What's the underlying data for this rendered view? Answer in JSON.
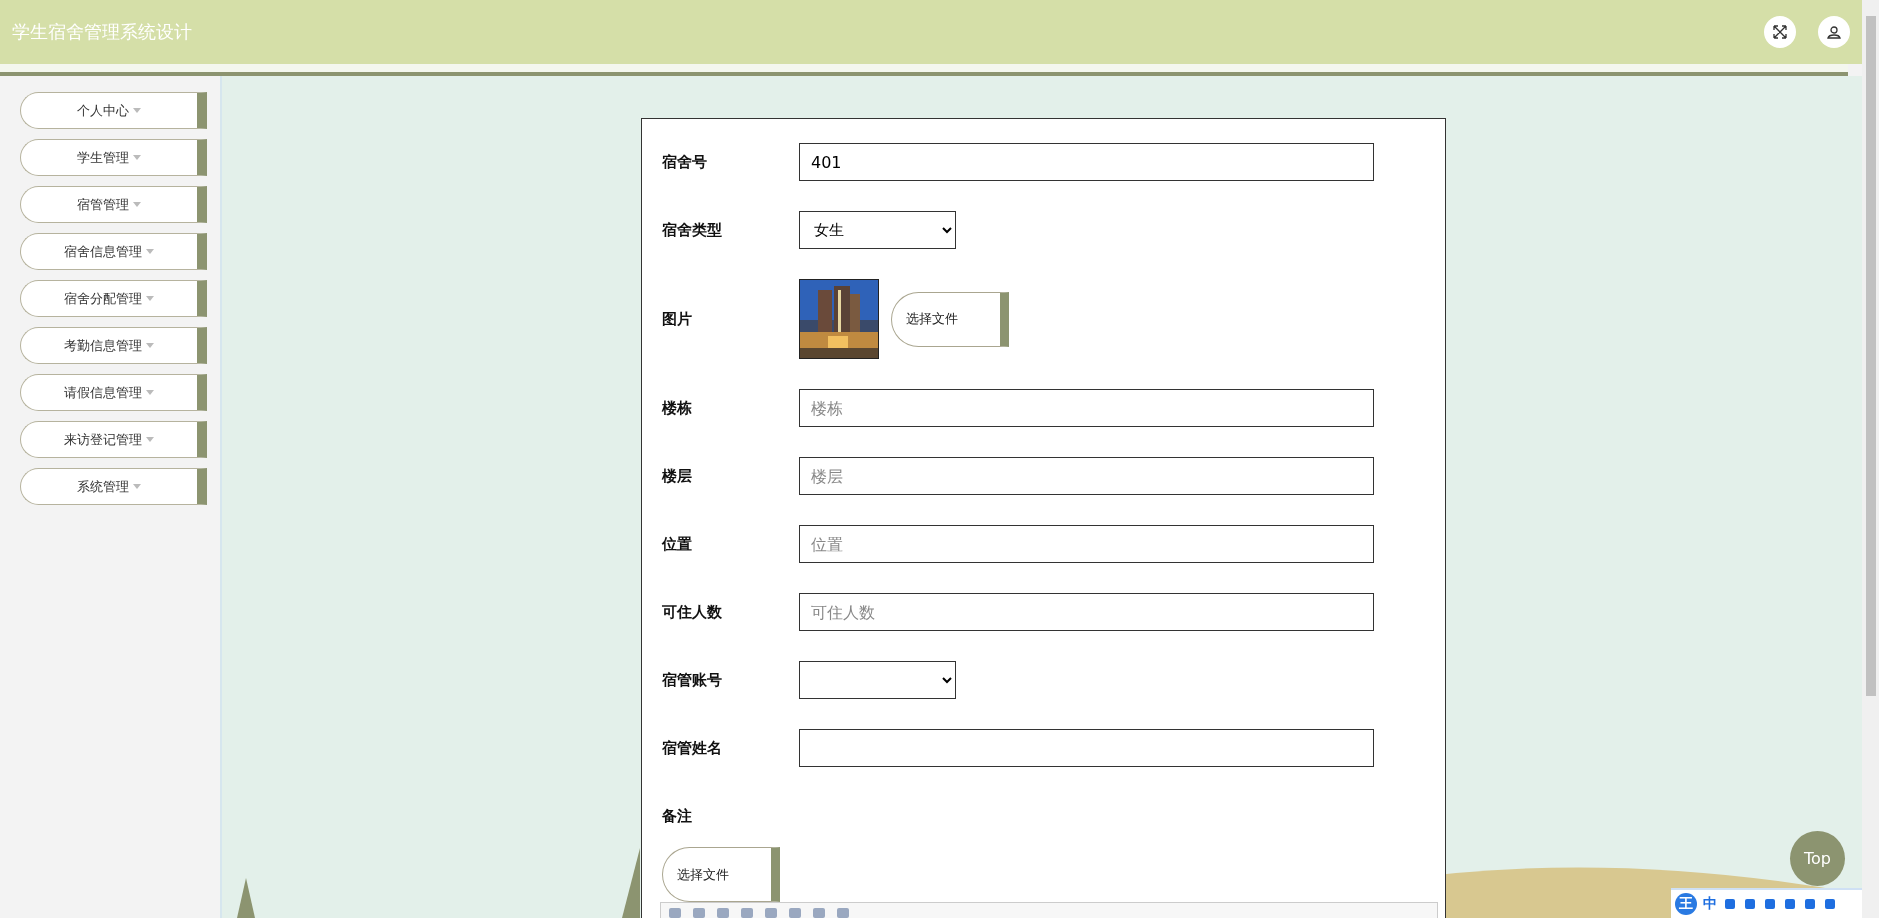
{
  "header": {
    "title": "学生宿舍管理系统设计"
  },
  "sidebar": {
    "items": [
      {
        "label": "个人中心"
      },
      {
        "label": "学生管理"
      },
      {
        "label": "宿管管理"
      },
      {
        "label": "宿舍信息管理"
      },
      {
        "label": "宿舍分配管理"
      },
      {
        "label": "考勤信息管理"
      },
      {
        "label": "请假信息管理"
      },
      {
        "label": "来访登记管理"
      },
      {
        "label": "系统管理"
      }
    ]
  },
  "form": {
    "fields": [
      {
        "kind": "text",
        "label": "宿舍号",
        "value": "401"
      },
      {
        "kind": "select",
        "label": "宿舍类型",
        "value": "女生"
      },
      {
        "label": "图片",
        "button": "选择文件"
      },
      {
        "kind": "text",
        "label": "楼栋",
        "placeholder": "楼栋"
      },
      {
        "kind": "text",
        "label": "楼层",
        "placeholder": "楼层"
      },
      {
        "kind": "text",
        "label": "位置",
        "placeholder": "位置"
      },
      {
        "kind": "text",
        "label": "可住人数",
        "placeholder": "可住人数"
      },
      {
        "kind": "select",
        "label": "宿管账号"
      },
      {
        "kind": "text",
        "label": "宿管姓名"
      },
      {
        "kind": "editor",
        "label": "备注",
        "button": "选择文件"
      }
    ]
  },
  "top_button": "Top",
  "ime_toolbar": {
    "logo": "王",
    "mode": "中"
  }
}
